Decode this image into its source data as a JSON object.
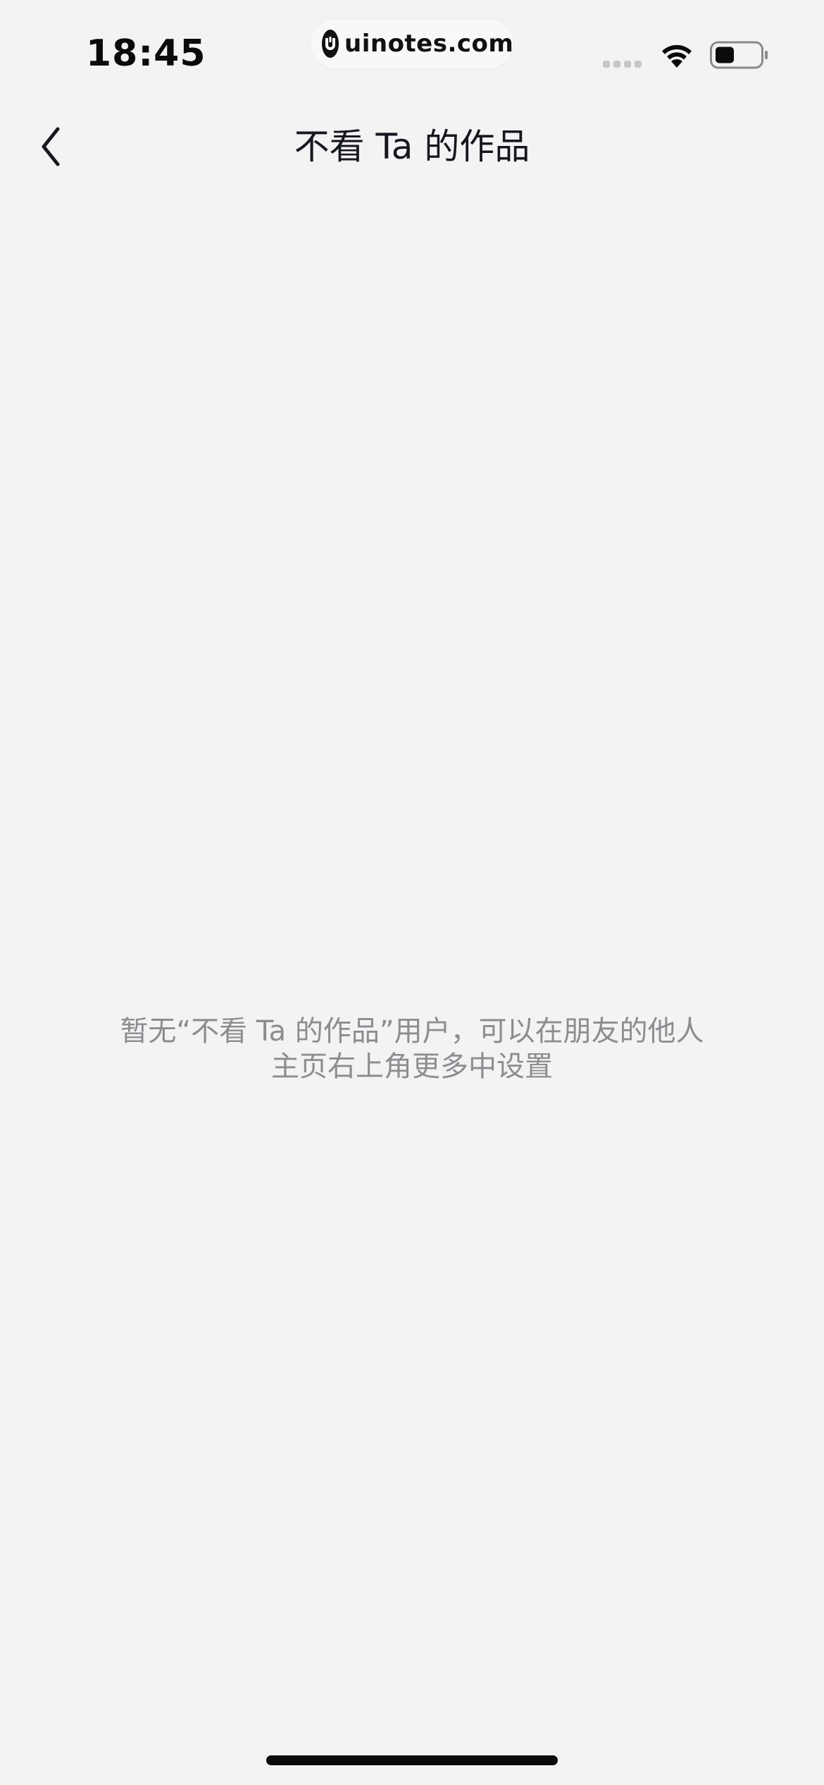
{
  "status_bar": {
    "time": "18:45",
    "url": "uinotes.com",
    "icons": [
      "signal-dots-icon",
      "wifi-icon",
      "battery-icon"
    ]
  },
  "nav": {
    "back_icon": "chevron-left-icon",
    "title": "不看 Ta 的作品"
  },
  "empty_state": {
    "line1": "暂无“不看 Ta 的作品”用户，可以在朋友的他人",
    "line2": "主页右上角更多中设置"
  },
  "colors": {
    "background": "#f3f3f3",
    "title": "#16181f",
    "muted_text": "#8c8d91"
  }
}
